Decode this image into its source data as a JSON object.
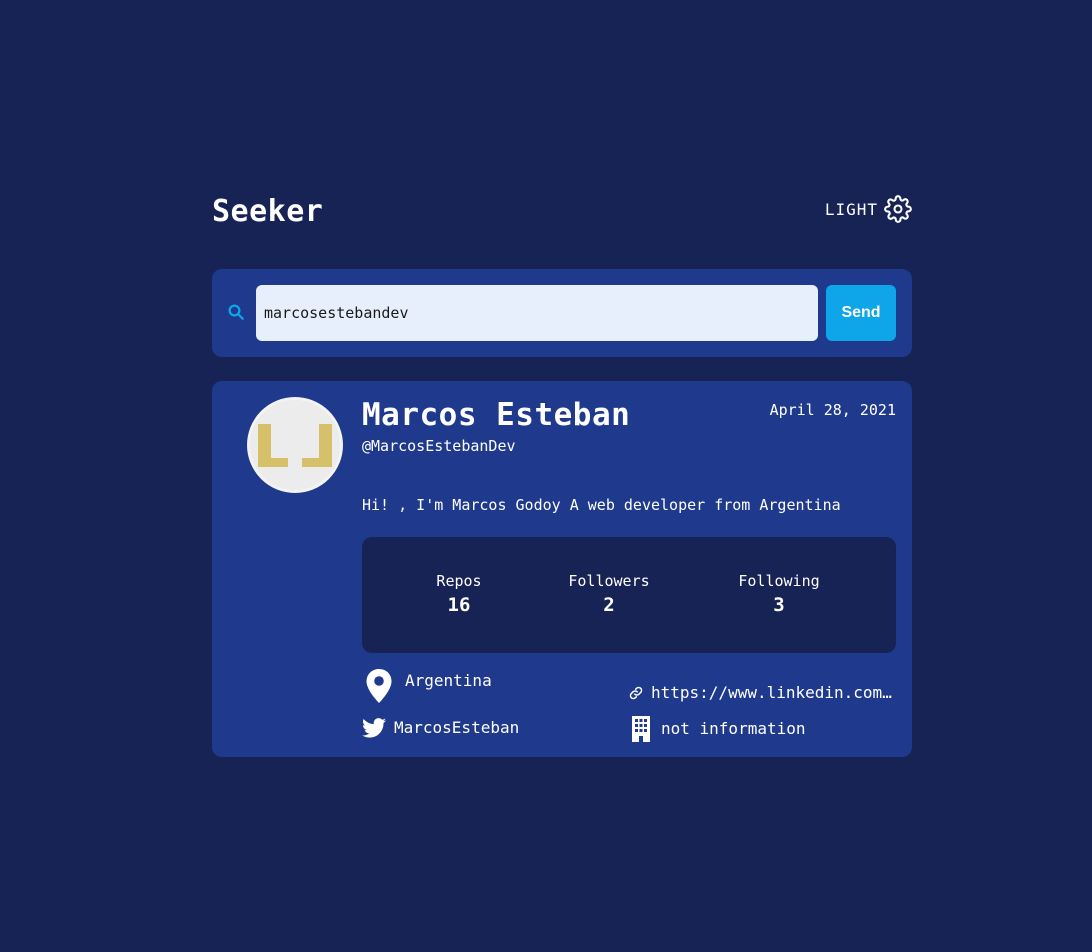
{
  "app": {
    "title": "Seeker",
    "theme_label": "LIGHT"
  },
  "search": {
    "value": "marcosestebandev",
    "send_label": "Send"
  },
  "profile": {
    "name": "Marcos Esteban",
    "handle": "@MarcosEstebanDev",
    "joined": "April 28, 2021",
    "bio": "Hi! , I'm Marcos Godoy A web developer from Argentina",
    "stats": [
      {
        "label": "Repos",
        "value": "16"
      },
      {
        "label": "Followers",
        "value": "2"
      },
      {
        "label": "Following",
        "value": "3"
      }
    ],
    "location": "Argentina",
    "website": "https://www.linkedin.com/in/marcosestebandev/",
    "twitter": "MarcosEsteban",
    "company": "not information"
  },
  "colors": {
    "background": "#172354",
    "card": "#1f3a8c",
    "accent": "#0ea5e9",
    "input": "#e7effc",
    "text": "#ffffff"
  },
  "icons": {
    "theme": "gear-icon",
    "search": "search-icon",
    "location": "map-pin-icon",
    "website": "link-icon",
    "twitter": "twitter-icon",
    "company": "building-icon"
  }
}
